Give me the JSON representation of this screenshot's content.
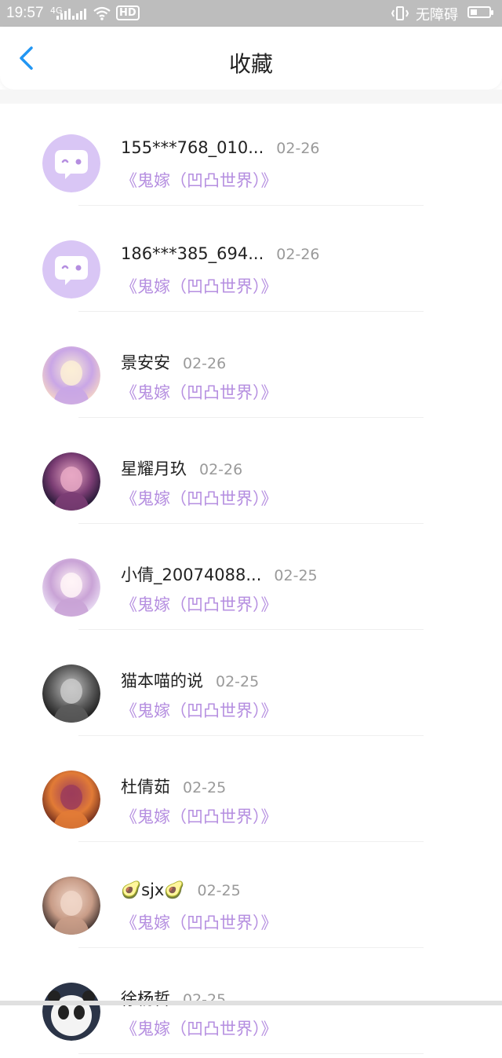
{
  "status_bar": {
    "time": "19:57",
    "signal_label": "4G",
    "network_label": "HD",
    "accessibility_label": "无障碍",
    "battery_level": 0.35
  },
  "header": {
    "title": "收藏"
  },
  "favorites": [
    {
      "name": "155***768_010...",
      "date": "02-26",
      "book": "《鬼嫁（凹凸世界）》",
      "avatar": "default-chat-avatar"
    },
    {
      "name": "186***385_694...",
      "date": "02-26",
      "book": "《鬼嫁（凹凸世界）》",
      "avatar": "default-chat-avatar"
    },
    {
      "name": "景安安",
      "date": "02-26",
      "book": "《鬼嫁（凹凸世界）》",
      "avatar": "anime-avatar"
    },
    {
      "name": "星耀月玖",
      "date": "02-26",
      "book": "《鬼嫁（凹凸世界）》",
      "avatar": "anime-avatar"
    },
    {
      "name": "小倩_20074088...",
      "date": "02-25",
      "book": "《鬼嫁（凹凸世界）》",
      "avatar": "anime-avatar"
    },
    {
      "name": "猫本喵的说",
      "date": "02-25",
      "book": "《鬼嫁（凹凸世界）》",
      "avatar": "anime-avatar"
    },
    {
      "name": "杜倩茹",
      "date": "02-25",
      "book": "《鬼嫁（凹凸世界）》",
      "avatar": "anime-avatar"
    },
    {
      "name": "🥑sjx🥑",
      "date": "02-25",
      "book": "《鬼嫁（凹凸世界）》",
      "avatar": "photo-avatar"
    },
    {
      "name": "徐杨哲",
      "date": "02-25",
      "book": "《鬼嫁（凹凸世界）》",
      "avatar": "panda-avatar"
    }
  ],
  "colors": {
    "accent_purple": "#b58ee0",
    "back_arrow": "#2196f3",
    "default_avatar_bg": "#d9c6f5"
  }
}
